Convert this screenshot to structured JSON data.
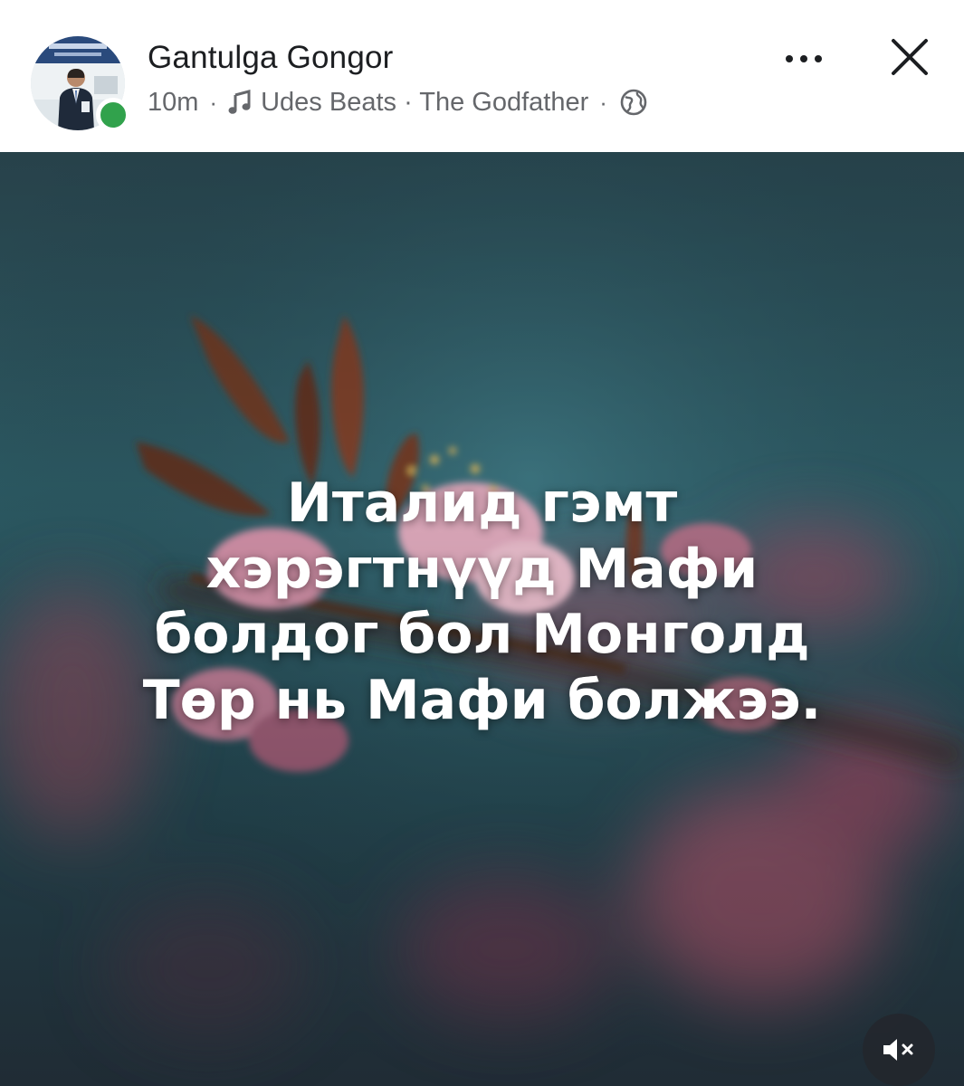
{
  "post": {
    "author": {
      "name": "Gantulga Gongor",
      "online": true
    },
    "meta": {
      "time": "10m",
      "separator": "·",
      "music_icon": "music-note-icon",
      "song": "Udes Beats · The Godfather",
      "privacy_icon": "globe-icon"
    },
    "actions": {
      "more_icon": "more-options-icon",
      "close_icon": "close-icon"
    },
    "media": {
      "overlay_lines": [
        "Италид гэмт",
        "хэрэгтнүүд Мафи",
        "болдог бол Монголд",
        "Төр нь Мафи болжээ."
      ],
      "mute_icon": "speaker-muted-icon"
    }
  },
  "colors": {
    "name_text": "#1c1e21",
    "meta_text": "#65676b",
    "online_dot": "#31a24c",
    "overlay_text": "#ffffff",
    "background_teal": "#2c5a63"
  }
}
